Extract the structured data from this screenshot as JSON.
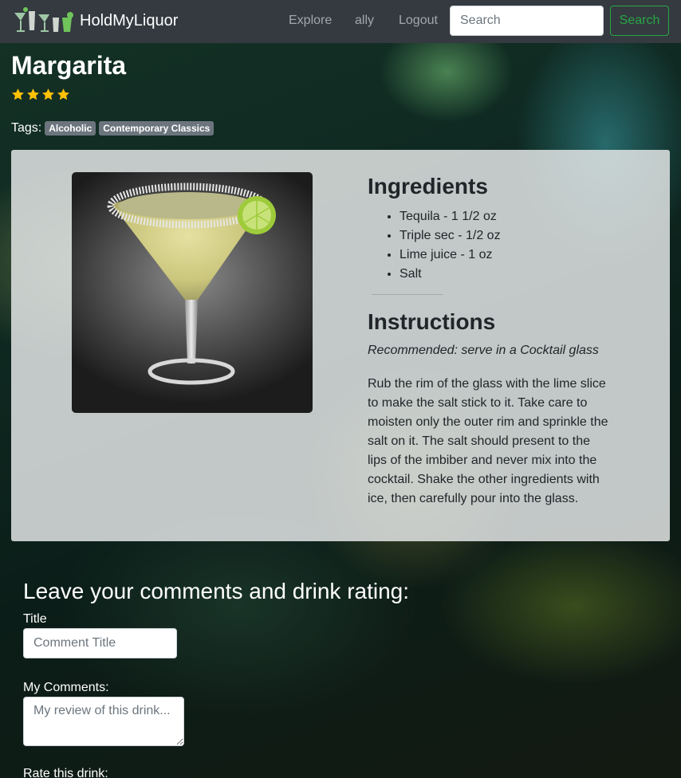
{
  "navbar": {
    "brand": "HoldMyLiquor",
    "links": [
      "Explore",
      "ally",
      "Logout"
    ],
    "search_placeholder": "Search",
    "search_button": "Search"
  },
  "drink": {
    "name": "Margarita",
    "rating_stars": 4,
    "tags_label": "Tags:",
    "tags": [
      "Alcoholic",
      "Contemporary Classics"
    ],
    "ingredients_title": "Ingredients",
    "ingredients": [
      "Tequila - 1 1/2 oz",
      "Triple sec - 1/2 oz",
      "Lime juice - 1 oz",
      "Salt"
    ],
    "instructions_title": "Instructions",
    "recommended": "Recommended: serve in a Cocktail glass",
    "instructions": "Rub the rim of the glass with the lime slice to make the salt stick to it. Take care to moisten only the outer rim and sprinkle the salt on it. The salt should present to the lips of the imbiber and never mix into the cocktail. Shake the other ingredients with ice, then carefully pour into the glass."
  },
  "comments": {
    "heading": "Leave your comments and drink rating:",
    "title_label": "Title",
    "title_placeholder": "Comment Title",
    "comments_label": "My Comments:",
    "comments_placeholder": "My review of this drink...",
    "rate_label": "Rate this drink:"
  },
  "colors": {
    "navbar_bg": "#343a40",
    "search_button": "#28a745",
    "star": "#ffc107",
    "tag_bg": "#6c757d"
  }
}
